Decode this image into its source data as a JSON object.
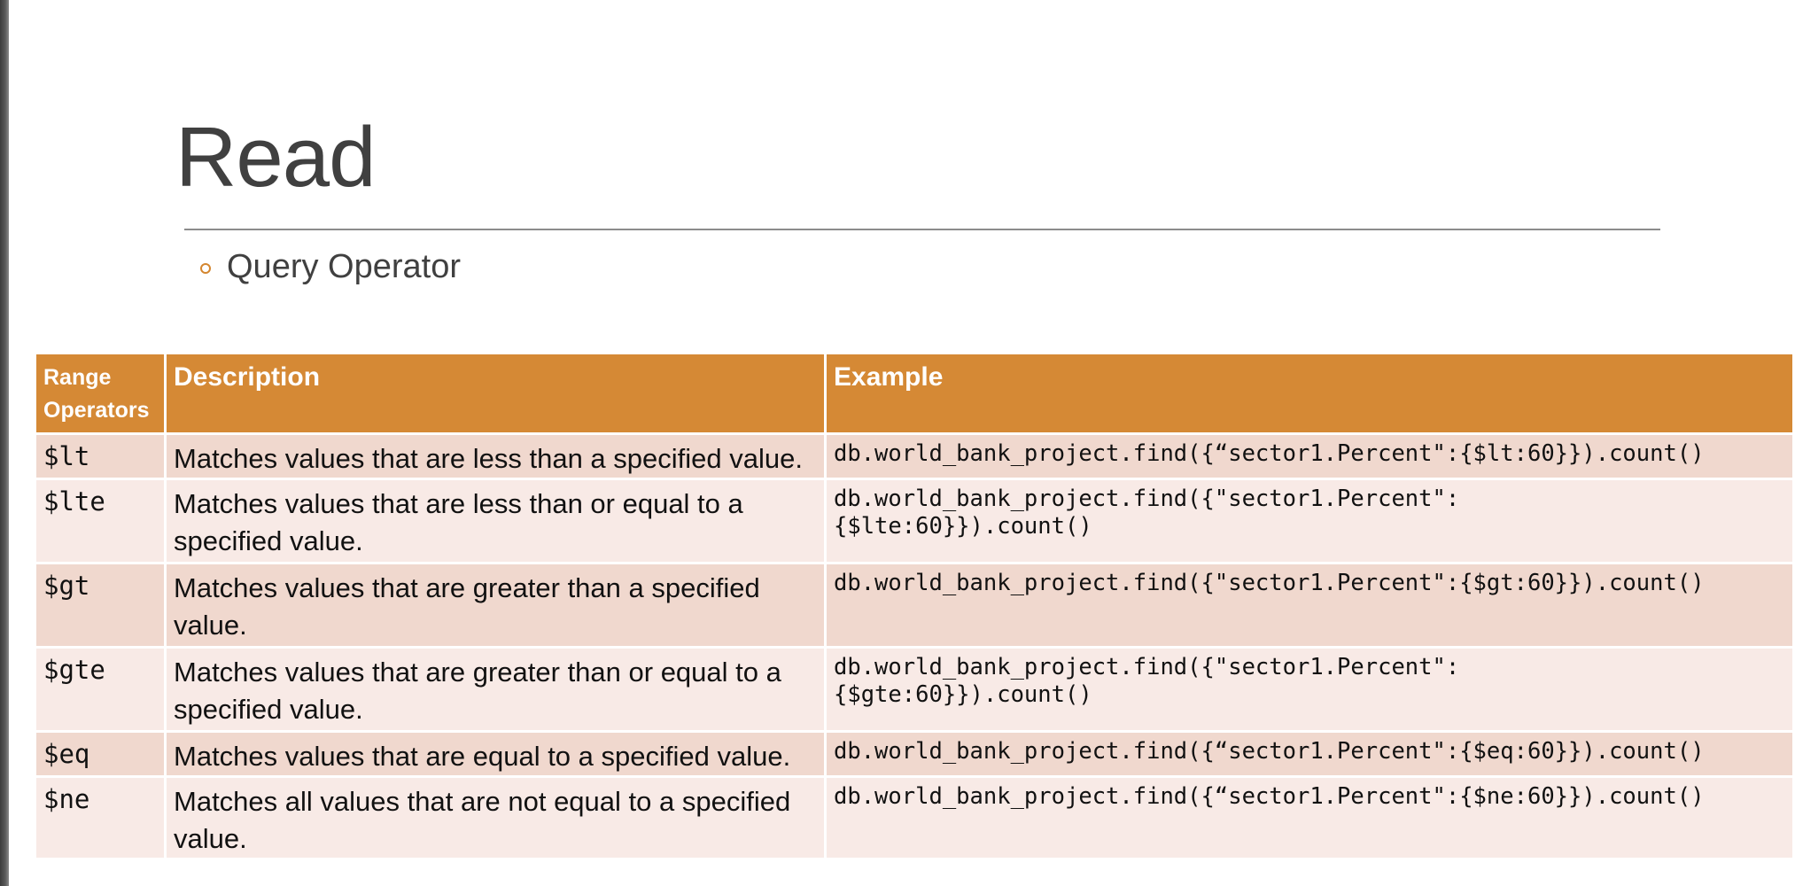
{
  "slide": {
    "title": "Read",
    "bullet": "Query Operator"
  },
  "table": {
    "headers": {
      "operator": "Range Operators",
      "description": "Description",
      "example": "Example"
    },
    "rows": [
      {
        "operator": "$lt",
        "description": "Matches values that are less than a specified value.",
        "example": "db.world_bank_project.find({“sector1.Percent\":{$lt:60}}).count()"
      },
      {
        "operator": "$lte",
        "description": "Matches values that are less than or equal to a specified value.",
        "example": "db.world_bank_project.find({\"sector1.Percent\":\n{$lte:60}}).count()"
      },
      {
        "operator": "$gt",
        "description": "Matches values that are greater than a specified value.",
        "example": "db.world_bank_project.find({\"sector1.Percent\":{$gt:60}}).count()"
      },
      {
        "operator": "$gte",
        "description": "Matches values that are greater than or equal to a specified value.",
        "example": "db.world_bank_project.find({\"sector1.Percent\":\n{$gte:60}}).count()"
      },
      {
        "operator": "$eq",
        "description": "Matches values that are equal to a specified value.",
        "example": "db.world_bank_project.find({“sector1.Percent\":{$eq:60}}).count()"
      },
      {
        "operator": "$ne",
        "description": "Matches all values that are not equal to a specified value.",
        "example": "db.world_bank_project.find({“sector1.Percent\":{$ne:60}}).count()"
      }
    ]
  },
  "colors": {
    "header_fill": "#d58935",
    "row_odd": "#f0d8ce",
    "row_even": "#f8eae6",
    "title_text": "#404040",
    "bullet_mark": "#d4862f"
  }
}
